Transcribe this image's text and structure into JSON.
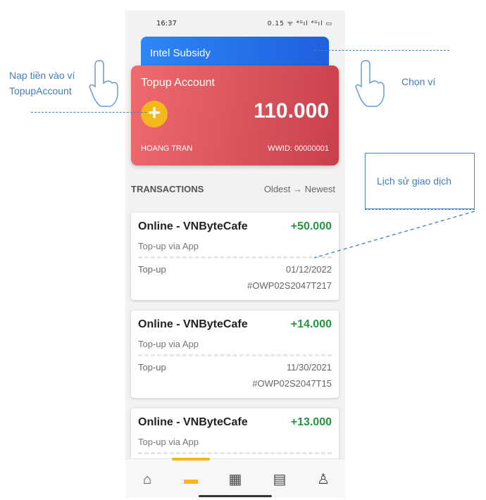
{
  "status_bar": {
    "time": "16:37",
    "icons_text": "0.15 ᯤ ⁴ᴳıl ⁴ᴳıl ▭"
  },
  "wallets": {
    "back_card": {
      "name": "Intel Subsidy"
    },
    "front_card": {
      "name": "Topup Account",
      "balance": "110.000",
      "holder": "HOANG TRAN",
      "wwid": "WWID: 00000001",
      "add_icon": "plus-icon"
    }
  },
  "transactions": {
    "header": "TRANSACTIONS",
    "sort_from": "Oldest",
    "sort_arrow": "→",
    "sort_to": "Newest",
    "items": [
      {
        "title": "Online - VNByteCafe",
        "amount": "+50.000",
        "subtitle": "Top-up via App",
        "type": "Top-up",
        "date": "01/12/2022",
        "code": "#OWP02S2047T217"
      },
      {
        "title": "Online - VNByteCafe",
        "amount": "+14.000",
        "subtitle": "Top-up via App",
        "type": "Top-up",
        "date": "11/30/2021",
        "code": "#OWP02S2047T15"
      },
      {
        "title": "Online - VNByteCafe",
        "amount": "+13.000",
        "subtitle": "Top-up via App",
        "type": "",
        "date": "",
        "code": ""
      }
    ]
  },
  "bottom_nav": [
    {
      "icon": "home-icon",
      "glyph": "⌂"
    },
    {
      "icon": "wallet-icon",
      "glyph": "▬",
      "active": true
    },
    {
      "icon": "qr-code-icon",
      "glyph": "▦"
    },
    {
      "icon": "receipt-icon",
      "glyph": "▤"
    },
    {
      "icon": "user-icon",
      "glyph": "♙"
    }
  ],
  "annotations": {
    "topup_line1": "Nạp tiền vào ví",
    "topup_line2": "TopupAccount",
    "choose_wallet": "Chọn ví",
    "history": "Lịch sử giao dịch"
  },
  "colors": {
    "accent": "#f4b81c",
    "card_red": "#e05a62",
    "card_blue": "#2f86f5",
    "positive": "#1e9a3c",
    "annotation": "#3f7fc2"
  }
}
